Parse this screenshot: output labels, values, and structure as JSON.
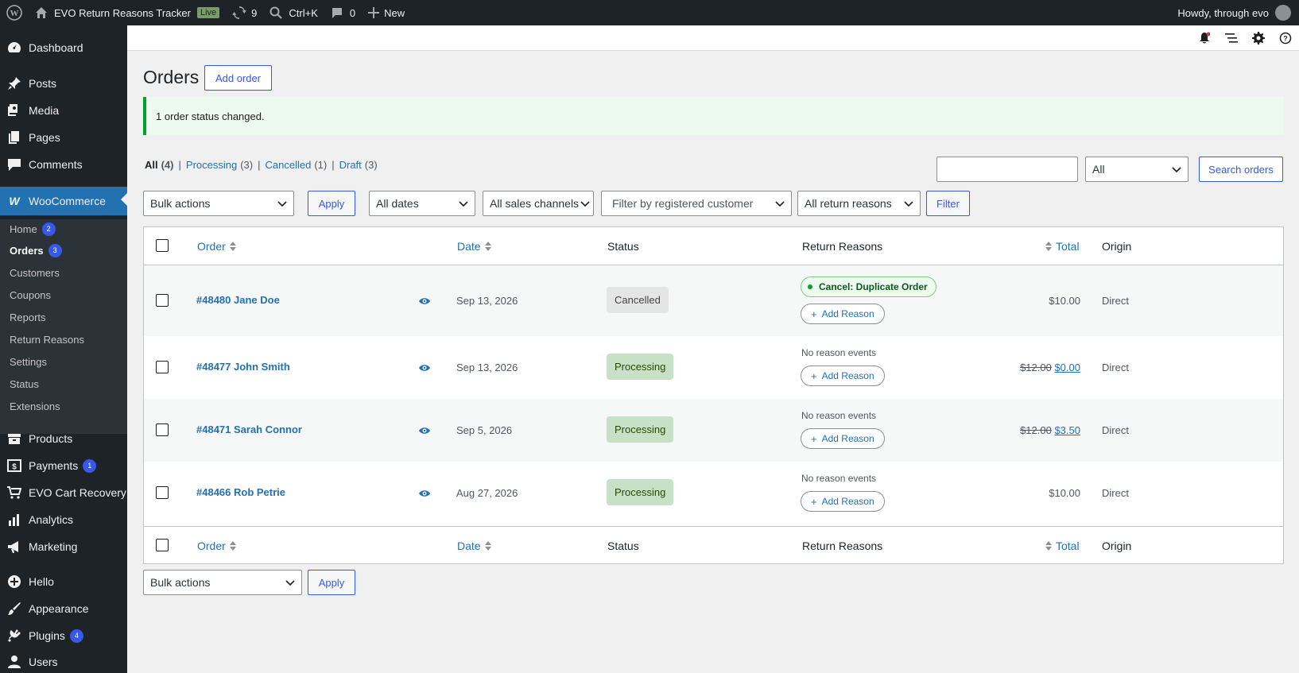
{
  "adminbar": {
    "site_name": "EVO Return Reasons Tracker",
    "live_badge": "Live",
    "updates_count": "9",
    "search_shortcut": "Ctrl+K",
    "comments_count": "0",
    "new_label": "New",
    "howdy": "Howdy, through evo"
  },
  "sidebar": {
    "dashboard": "Dashboard",
    "posts": "Posts",
    "media": "Media",
    "pages": "Pages",
    "comments": "Comments",
    "woocommerce": "WooCommerce",
    "sub": {
      "home": "Home",
      "home_count": "2",
      "orders": "Orders",
      "orders_count": "3",
      "customers": "Customers",
      "coupons": "Coupons",
      "reports": "Reports",
      "return_reasons": "Return Reasons",
      "settings": "Settings",
      "status": "Status",
      "extensions": "Extensions"
    },
    "products": "Products",
    "payments": "Payments",
    "payments_count": "1",
    "evo_cart": "EVO Cart Recovery",
    "analytics": "Analytics",
    "marketing": "Marketing",
    "hello": "Hello",
    "appearance": "Appearance",
    "plugins": "Plugins",
    "plugins_count": "4",
    "users": "Users"
  },
  "page": {
    "title": "Orders",
    "add_order": "Add order",
    "notice": "1 order status changed."
  },
  "views": {
    "all": "All",
    "all_count": "(4)",
    "processing": "Processing",
    "processing_count": "(3)",
    "cancelled": "Cancelled",
    "cancelled_count": "(1)",
    "draft": "Draft",
    "draft_count": "(3)"
  },
  "search": {
    "status_select": "All",
    "button": "Search orders"
  },
  "filters": {
    "bulk_actions": "Bulk actions",
    "apply": "Apply",
    "dates": "All dates",
    "channels": "All sales channels",
    "customer": "Filter by registered customer",
    "return_reasons": "All return reasons",
    "filter": "Filter"
  },
  "table": {
    "headers": {
      "order": "Order",
      "date": "Date",
      "status": "Status",
      "return_reasons": "Return Reasons",
      "total": "Total",
      "origin": "Origin"
    },
    "rows": [
      {
        "order": "#48480 Jane Doe",
        "date": "Sep 13, 2026",
        "status": "Cancelled",
        "reason": "Cancel: Duplicate Order",
        "add_reason": "Add Reason",
        "total": "$10.00",
        "origin": "Direct"
      },
      {
        "order": "#48477 John Smith",
        "date": "Sep 13, 2026",
        "status": "Processing",
        "no_events": "No reason events",
        "add_reason": "Add Reason",
        "total_old": "$12.00",
        "total_new": "$0.00",
        "origin": "Direct"
      },
      {
        "order": "#48471 Sarah Connor",
        "date": "Sep 5, 2026",
        "status": "Processing",
        "no_events": "No reason events",
        "add_reason": "Add Reason",
        "total_old": "$12.00",
        "total_new": "$3.50",
        "origin": "Direct"
      },
      {
        "order": "#48466 Rob Petrie",
        "date": "Aug 27, 2026",
        "status": "Processing",
        "no_events": "No reason events",
        "add_reason": "Add Reason",
        "total": "$10.00",
        "origin": "Direct"
      }
    ]
  },
  "bottom": {
    "bulk_actions": "Bulk actions",
    "apply": "Apply"
  },
  "colors": {
    "admin_dark": "#1d2327",
    "accent": "#2271b1",
    "wc_blue": "#3858e9",
    "processing_bg": "#c6e1c6",
    "cancelled_bg": "#e5e5e5",
    "notice_border": "#00a32a"
  }
}
